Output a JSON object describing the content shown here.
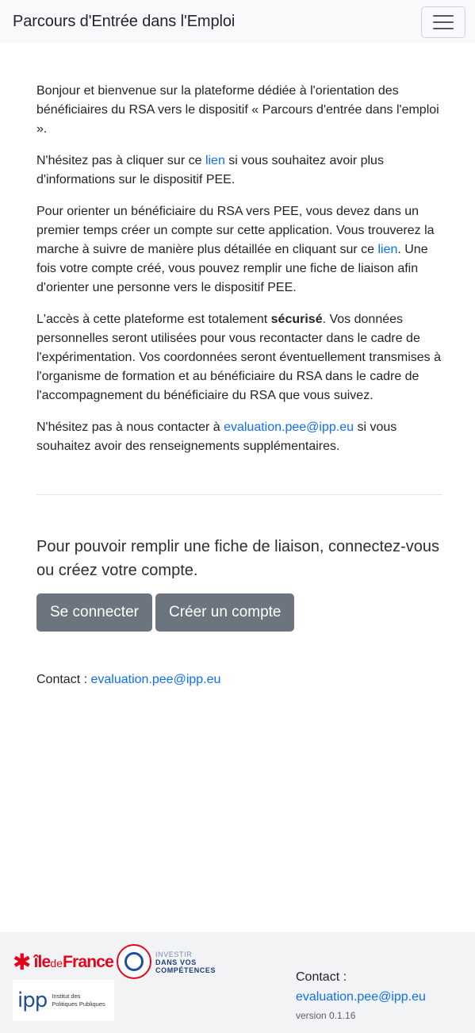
{
  "navbar": {
    "brand": "Parcours d'Entrée dans l'Emploi",
    "menu_icon": "hamburger-menu-icon"
  },
  "intro": {
    "p1": "Bonjour et bienvenue sur la plateforme dédiée à l'orientation des bénéficiaires du RSA vers le dispositif « Parcours d'entrée dans l'emploi ».",
    "p2_before": "N'hésitez pas à cliquer sur ce ",
    "p2_link": "lien",
    "p2_after": " si vous souhaitez avoir plus d'informations sur le dispositif PEE.",
    "p3_before": "Pour orienter un bénéficiaire du RSA vers PEE, vous devez dans un premier temps créer un compte sur cette application. Vous trouverez la marche à suivre de manière plus détaillée en cliquant sur ce ",
    "p3_link": "lien",
    "p3_after": ". Une fois votre compte créé, vous pouvez remplir une fiche de liaison afin d'orienter une personne vers le dispositif PEE.",
    "p4_before": "L'accès à cette plateforme est totalement ",
    "p4_bold": "sécurisé",
    "p4_after": ". Vos données personnelles seront utilisées pour vous recontacter dans le cadre de l'expérimentation. Vos coordonnées seront éventuellement transmises à l'organisme de formation et au bénéficiaire du RSA dans le cadre de l'accompagnement du bénéficiaire du RSA que vous suivez.",
    "p5_before": "N'hésitez pas à nous contacter à ",
    "p5_link": "evaluation.pee@ipp.eu",
    "p5_after": " si vous souhaitez avoir des renseignements supplémentaires."
  },
  "login": {
    "lead": "Pour pouvoir remplir une fiche de liaison, connectez-vous ou créez votre compte.",
    "connect_label": "Se connecter",
    "create_label": "Créer un compte"
  },
  "contact": {
    "label": "Contact : ",
    "email": "evaluation.pee@ipp.eu"
  },
  "footer": {
    "idf_logo": {
      "star": "✱",
      "ile": "île",
      "de": "de",
      "france": "France"
    },
    "invest_logo": {
      "line1": "INVESTIR",
      "line2": "DANS VOS",
      "line3": "COMPÉTENCES"
    },
    "ipp_logo": {
      "mark": "ipp",
      "name1": "Institut des",
      "name2": "Politiques Publiques"
    },
    "contact_label": "Contact :",
    "contact_email": "evaluation.pee@ipp.eu",
    "version": "version 0.1.16"
  },
  "colors": {
    "link": "#0d6efd",
    "button": "#6c757d",
    "navbar_bg": "#f8f9fa",
    "footer_bg": "#f2f3f4",
    "idf_red": "#e3051b"
  }
}
